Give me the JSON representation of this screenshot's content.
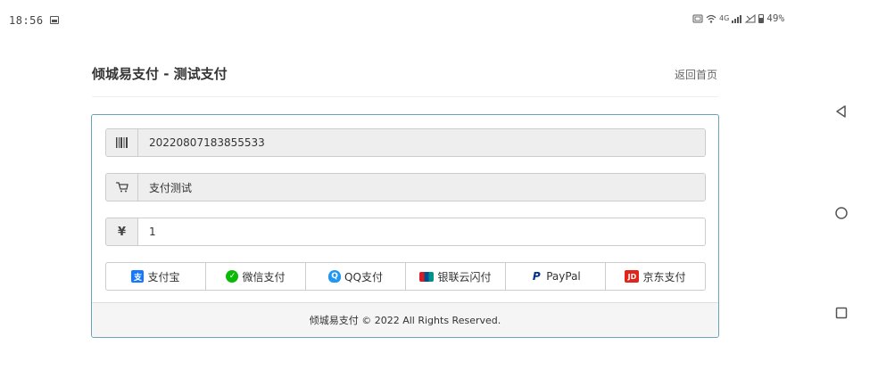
{
  "status_bar": {
    "time": "18:56",
    "network": "4G",
    "battery": "49%"
  },
  "header": {
    "title": "倾城易支付 - 测试支付",
    "home_link": "返回首页"
  },
  "form": {
    "order_no": "20220807183855533",
    "product_name": "支付测试",
    "amount": "1",
    "amount_symbol": "¥"
  },
  "payment_methods": [
    {
      "label": "支付宝",
      "icon": "alipay-icon",
      "color": "#1677ff"
    },
    {
      "label": "微信支付",
      "icon": "wechat-icon",
      "color": "#09bb07"
    },
    {
      "label": "QQ支付",
      "icon": "qq-icon",
      "color": "#2196f3"
    },
    {
      "label": "银联云闪付",
      "icon": "unionpay-icon",
      "color": "#d71e28"
    },
    {
      "label": "PayPal",
      "icon": "paypal-icon",
      "color": "#003087"
    },
    {
      "label": "京东支付",
      "icon": "jd-icon",
      "color": "#e1251b"
    }
  ],
  "footer": {
    "text": "倾城易支付 © 2022 All Rights Reserved."
  },
  "colors": {
    "panel_border": "#6aa3b8",
    "addon_bg": "#eeeeee",
    "footer_bg": "#f5f5f5"
  }
}
